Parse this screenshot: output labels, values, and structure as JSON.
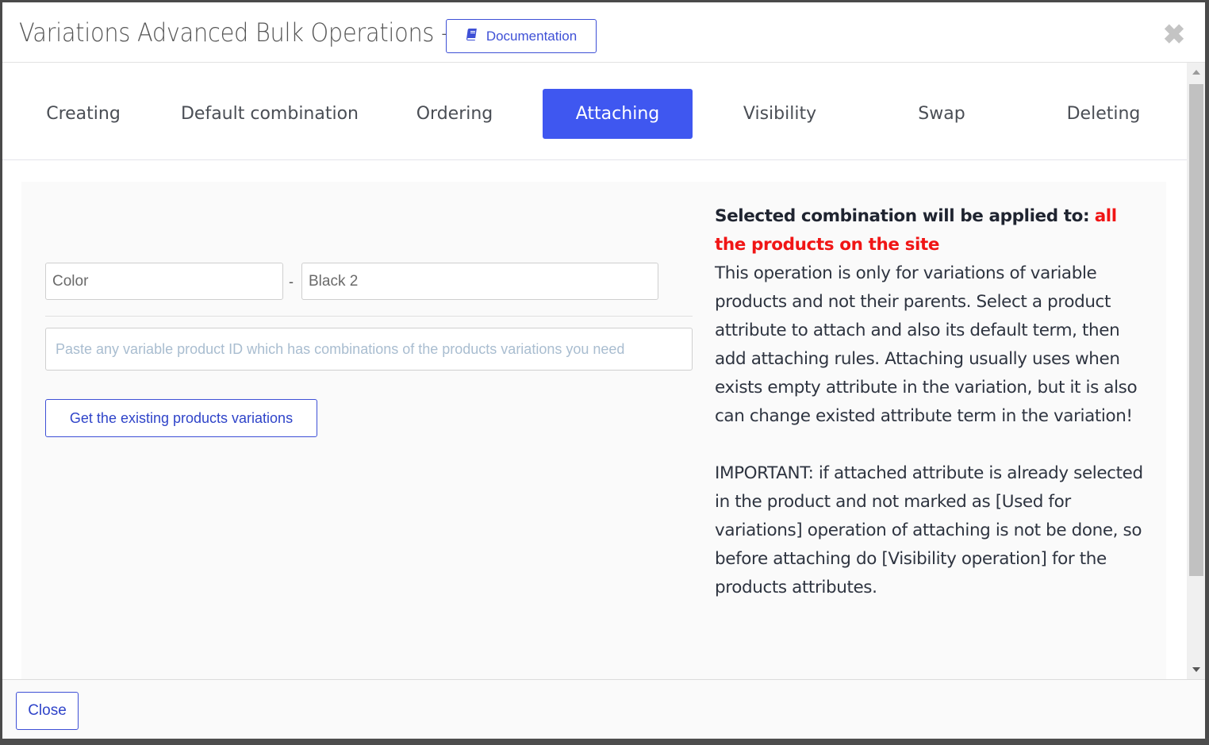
{
  "header": {
    "title": "Variations Advanced Bulk Operations -",
    "documentation_label": "Documentation",
    "documentation_icon": "book-icon",
    "close_icon": "close-icon"
  },
  "tabs": [
    {
      "label": "Creating",
      "active": false
    },
    {
      "label": "Default combination",
      "active": false
    },
    {
      "label": "Ordering",
      "active": false
    },
    {
      "label": "Attaching",
      "active": true
    },
    {
      "label": "Visibility",
      "active": false
    },
    {
      "label": "Swap",
      "active": false
    },
    {
      "label": "Deleting",
      "active": false
    }
  ],
  "form": {
    "attribute_value": "Color",
    "separator": "-",
    "term_value": "Black 2",
    "product_id_placeholder": "Paste any variable product ID which has combinations of the products variations you need",
    "get_button_label": "Get the existing products variations"
  },
  "info": {
    "applied_label": "Selected combination will be applied to:",
    "applied_target": "all the products on the site",
    "description": "This operation is only for variations of variable products and not their parents. Select a product attribute to attach and also its default term, then add attaching rules. Attaching usually uses when exists empty attribute in the variation, but it is also can change existed attribute term in the variation!",
    "important": "IMPORTANT: if attached attribute is already selected in the product and not marked as [Used for variations] operation of attaching is not be done, so before attaching do [Visibility operation] for the products attributes."
  },
  "footer": {
    "close_label": "Close"
  },
  "colors": {
    "accent": "#3f57f0",
    "warning_red": "#f01515"
  }
}
